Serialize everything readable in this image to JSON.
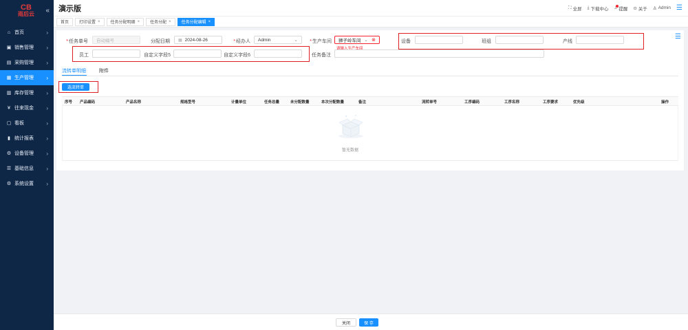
{
  "logo": {
    "glyph": "CB",
    "text": "雨后云"
  },
  "sidebar": {
    "collapse_icon": "double-chevron-left-icon",
    "items": [
      {
        "label": "首页",
        "icon": "home-icon",
        "glyph": "⌂"
      },
      {
        "label": "销售管理",
        "icon": "cart-icon",
        "glyph": "▣"
      },
      {
        "label": "采购管理",
        "icon": "purchase-icon",
        "glyph": "▤"
      },
      {
        "label": "生产管理",
        "icon": "production-icon",
        "glyph": "▦",
        "active": true
      },
      {
        "label": "库存管理",
        "icon": "inventory-icon",
        "glyph": "▥"
      },
      {
        "label": "往来现金",
        "icon": "cash-icon",
        "glyph": "¥"
      },
      {
        "label": "看板",
        "icon": "dashboard-icon",
        "glyph": "▢"
      },
      {
        "label": "统计报表",
        "icon": "report-icon",
        "glyph": "▮"
      },
      {
        "label": "设备管理",
        "icon": "gear-icon",
        "glyph": "⚙"
      },
      {
        "label": "基础信息",
        "icon": "info-icon",
        "glyph": "☰"
      },
      {
        "label": "系统设置",
        "icon": "settings-icon",
        "glyph": "⚙"
      }
    ]
  },
  "header": {
    "title": "演示版",
    "fullscreen": "全屏",
    "download": "下载中心",
    "remind": "提醒",
    "about": "关于",
    "user": "Admin"
  },
  "tabs": [
    {
      "label": "首页",
      "closable": false
    },
    {
      "label": "打印设置",
      "closable": true
    },
    {
      "label": "任务分配明细",
      "closable": true
    },
    {
      "label": "任务分配",
      "closable": true
    },
    {
      "label": "任务分配编辑",
      "closable": true,
      "active": true
    }
  ],
  "form": {
    "task_no_label": "任务单号",
    "task_no_placeholder": "自动编号",
    "date_label": "分配日期",
    "date_value": "2024-08-26",
    "handler_label": "经办人",
    "handler_value": "Admin",
    "workshop_label": "生产车间",
    "workshop_value": "狮子岭车间",
    "workshop_error": "请输入生产车间",
    "equipment_label": "设备",
    "team_label": "班组",
    "line_label": "产线",
    "employee_label": "员工",
    "custom5_label": "自定义字段5",
    "custom6_label": "自定义字段6",
    "remark_label": "任务备注"
  },
  "subtabs": {
    "detail": "流转单明细",
    "attachment": "附件"
  },
  "add_button": "选流转单",
  "table": {
    "columns": [
      "序号",
      "产品编码",
      "产品名称",
      "规格型号",
      "计量单位",
      "任务总量",
      "未分配数量",
      "本次分配数量",
      "备注",
      "流转单号",
      "工序编码",
      "工序名称",
      "工序要求",
      "优先级",
      "操作"
    ],
    "empty_text": "暂无数据"
  },
  "footer": {
    "close": "关闭",
    "save": "保 存"
  }
}
